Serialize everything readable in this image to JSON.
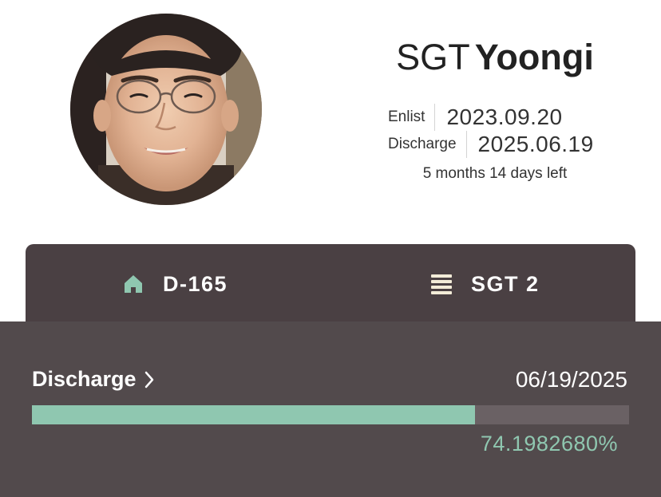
{
  "profile": {
    "rank": "SGT",
    "name": "Yoongi",
    "enlist_label": "Enlist",
    "enlist_date": "2023.09.20",
    "discharge_label": "Discharge",
    "discharge_date": "2025.06.19",
    "remaining": "5 months 14 days left"
  },
  "stats": {
    "dday": "D-165",
    "dday_icon": "home-icon",
    "rank_level": "SGT 2",
    "rank_icon": "rank-stripes-icon"
  },
  "progress": {
    "title": "Discharge",
    "date": "06/19/2025",
    "percent_text": "74.1982680%",
    "fraction": 0.74198268
  },
  "colors": {
    "accent": "#8fc7b0",
    "dark_bar": "#4a4043",
    "panel": "#524a4c"
  }
}
